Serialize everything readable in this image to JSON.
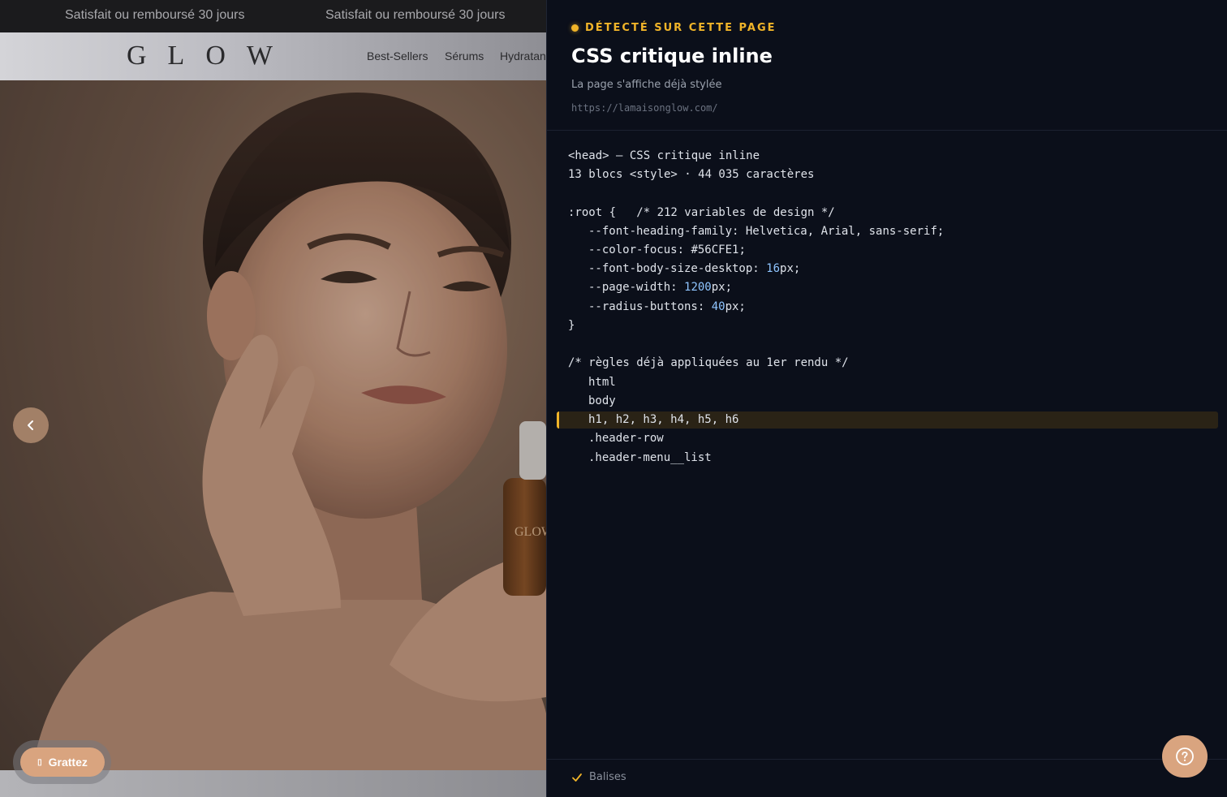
{
  "site": {
    "announcement": [
      "Satisfait ou remboursé 30 jours",
      "Satisfait ou remboursé 30 jours"
    ],
    "logo": "GLOW",
    "nav": [
      "Best-Sellers",
      "Sérums",
      "Hydratan"
    ],
    "bottle_label": "GLOW",
    "scratch_label": "Grattez",
    "icons": {
      "prev": "chevron-left-icon",
      "gift": "gift-icon"
    }
  },
  "panel": {
    "detect_label": "DÉTECTÉ SUR CETTE PAGE",
    "title": "CSS critique inline",
    "subtitle": "La page s'affiche déjà stylée",
    "url": "https://lamaisonglow.com/",
    "code": {
      "head_line": "<head> — CSS critique inline",
      "summary_line": "13 blocs <style> · 44 035 caractères",
      "root_open": ":root {   /* 212 variables de design */",
      "vars": [
        {
          "name": "--font-heading-family",
          "value": "Helvetica, Arial, sans-serif;"
        },
        {
          "name": "--color-focus",
          "value": "#56CFE1;"
        },
        {
          "name": "--font-body-size-desktop",
          "num": "16",
          "unit": "px;"
        },
        {
          "name": "--page-width",
          "num": "1200",
          "unit": "px;"
        },
        {
          "name": "--radius-buttons",
          "num": "40",
          "unit": "px;"
        }
      ],
      "root_close": "}",
      "rules_comment": "/* règles déjà appliquées au 1er rendu */",
      "selectors": [
        "html",
        "body",
        "h1, h2, h3, h4, h5, h6",
        ".header-row",
        ".header-menu__list"
      ],
      "highlighted_selector": "h1, h2, h3, h4, h5, h6"
    },
    "footer_label": "Balises",
    "accent": "#f0b429",
    "help_icon": "help-icon"
  }
}
